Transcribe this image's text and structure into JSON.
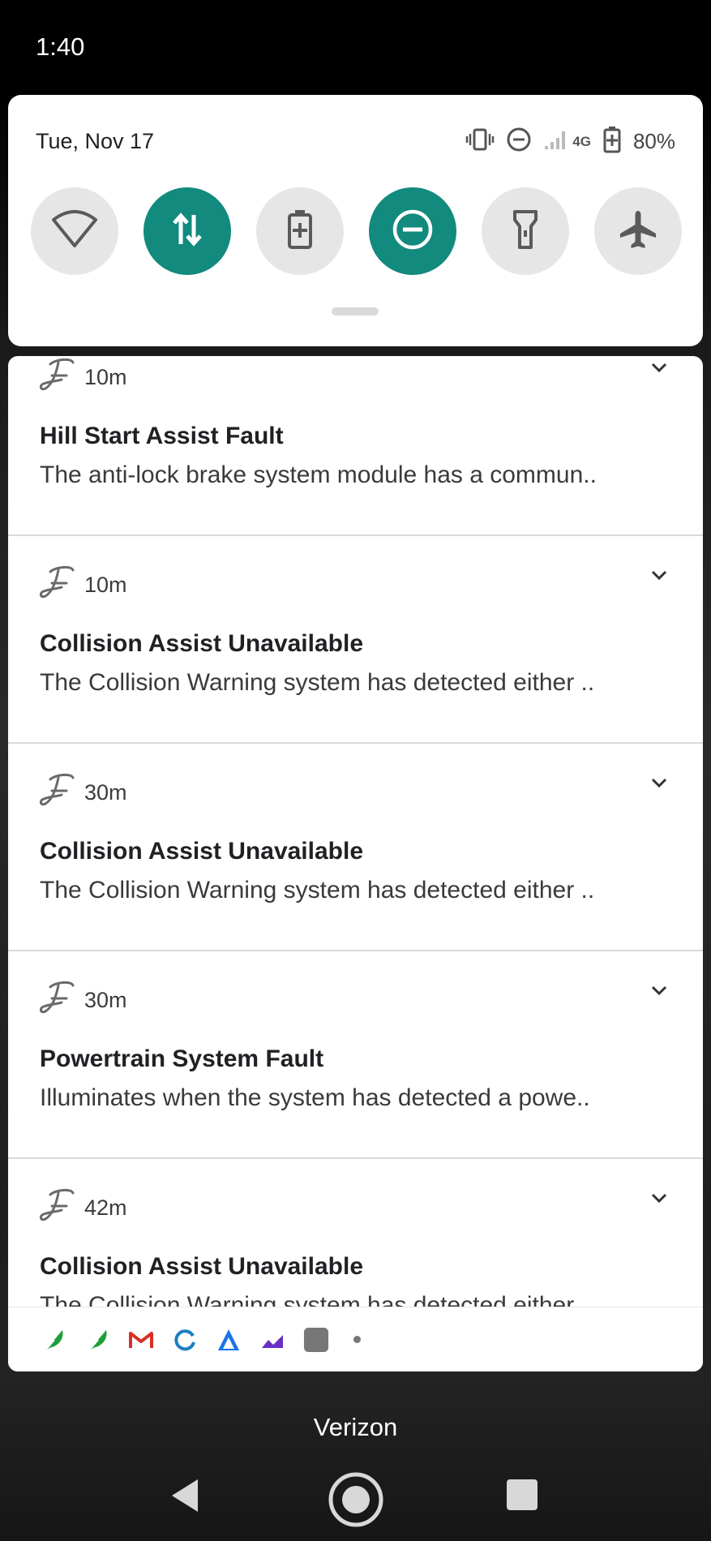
{
  "status_bar": {
    "time": "1:40"
  },
  "quick_settings": {
    "date": "Tue, Nov 17",
    "network_label": "4G",
    "battery_percent": "80%",
    "accent_color": "#128a7e",
    "tiles": [
      {
        "name": "wifi-icon",
        "active": false
      },
      {
        "name": "mobile-data-icon",
        "active": true
      },
      {
        "name": "battery-saver-icon",
        "active": false
      },
      {
        "name": "do-not-disturb-icon",
        "active": true
      },
      {
        "name": "flashlight-icon",
        "active": false
      },
      {
        "name": "airplane-mode-icon",
        "active": false
      }
    ]
  },
  "notifications": [
    {
      "time": "10m",
      "title": "Hill Start Assist Fault",
      "body": "The anti-lock brake system module has a commun.."
    },
    {
      "time": "10m",
      "title": "Collision Assist Unavailable",
      "body": "The Collision Warning system has detected either .."
    },
    {
      "time": "30m",
      "title": "Collision Assist Unavailable",
      "body": "The Collision Warning system has detected either .."
    },
    {
      "time": "30m",
      "title": "Powertrain System Fault",
      "body": "Illuminates when the system has detected a powe.."
    },
    {
      "time": "42m",
      "title": "Collision Assist Unavailable",
      "body": "The Collision Warning system has detected either .."
    }
  ],
  "shelf_icons": [
    "feather-icon",
    "feather-icon",
    "gmail-icon",
    "sync-icon",
    "arrow-app-icon",
    "chart-app-icon",
    "app-square-icon",
    "more-dot"
  ],
  "carrier": "Verizon"
}
